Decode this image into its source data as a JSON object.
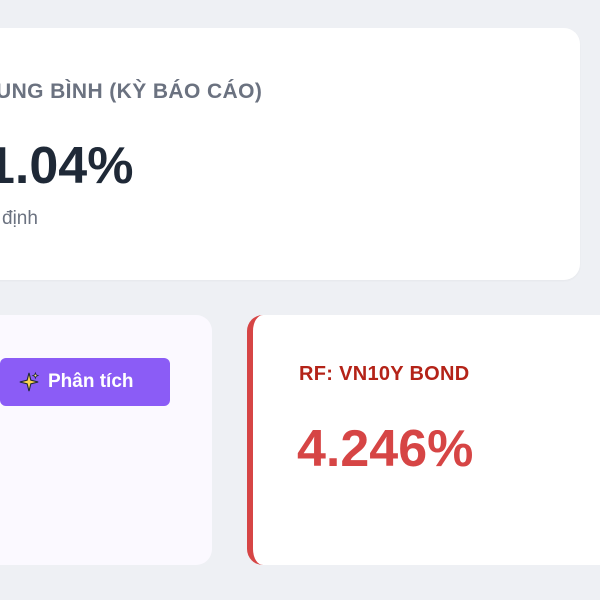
{
  "summary_card": {
    "label": "UNG BÌNH (KỲ BÁO CÁO)",
    "value": "1.04%",
    "sub": "định"
  },
  "analysis_card": {
    "button_label": "Phân tích",
    "button_icon": "sparkle-icon",
    "accent_color": "#8b5cf6"
  },
  "rf_card": {
    "label": "RF: VN10Y BOND",
    "value": "4.246%",
    "accent_color": "#d64545"
  }
}
